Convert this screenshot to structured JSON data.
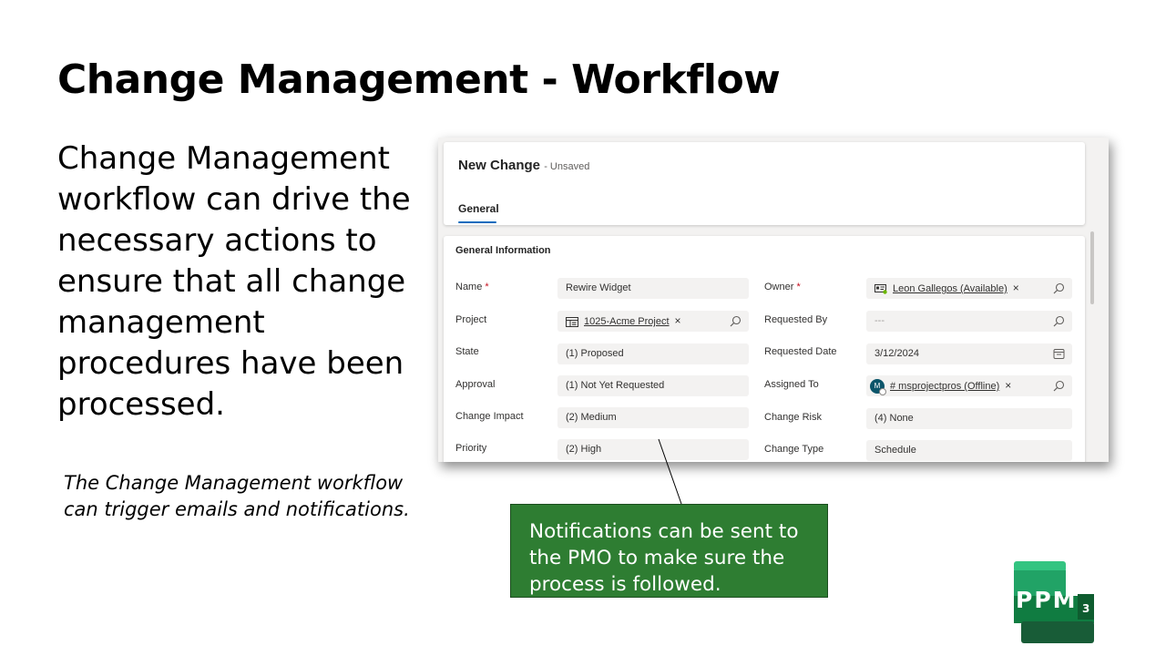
{
  "slide": {
    "title": "Change Management - Workflow",
    "body": "Change Management workflow can drive the necessary actions to ensure that all change management procedures have been processed.",
    "note": "The Change Management workflow can trigger emails and notifications."
  },
  "form": {
    "title": "New Change",
    "status": "- Unsaved",
    "tab_general": "General",
    "section_title": "General Information",
    "required_marker": "*",
    "fields": {
      "name": {
        "label": "Name",
        "value": "Rewire Widget"
      },
      "owner": {
        "label": "Owner",
        "value": "Leon Gallegos (Available)"
      },
      "project": {
        "label": "Project",
        "value": "1025-Acme Project"
      },
      "requested_by": {
        "label": "Requested By",
        "value": "---"
      },
      "state": {
        "label": "State",
        "value": "(1) Proposed"
      },
      "requested_date": {
        "label": "Requested Date",
        "value": "3/12/2024"
      },
      "approval": {
        "label": "Approval",
        "value": "(1) Not Yet Requested"
      },
      "assigned_to": {
        "label": "Assigned To",
        "value": "# msprojectpros (Offline)",
        "avatar_initial": "M"
      },
      "change_impact": {
        "label": "Change Impact",
        "value": "(2) Medium"
      },
      "change_risk": {
        "label": "Change Risk",
        "value": "(4) None"
      },
      "priority": {
        "label": "Priority",
        "value": "(2) High"
      },
      "change_type": {
        "label": "Change Type",
        "value": "Schedule"
      }
    },
    "remove_symbol": "×",
    "icons": {
      "search": "search-icon",
      "calendar": "calendar-icon",
      "project": "project-icon",
      "contact": "contact-card-icon"
    }
  },
  "callout": {
    "text": "Notifications can be sent to the PMO to make sure the process is followed."
  },
  "logo": {
    "text": "PPM",
    "superscript": "3"
  },
  "colors": {
    "callout_bg": "#2e7d32",
    "tab_underline": "#0f6cbd",
    "required": "#c50f1f",
    "logo_green": "#21a366"
  }
}
